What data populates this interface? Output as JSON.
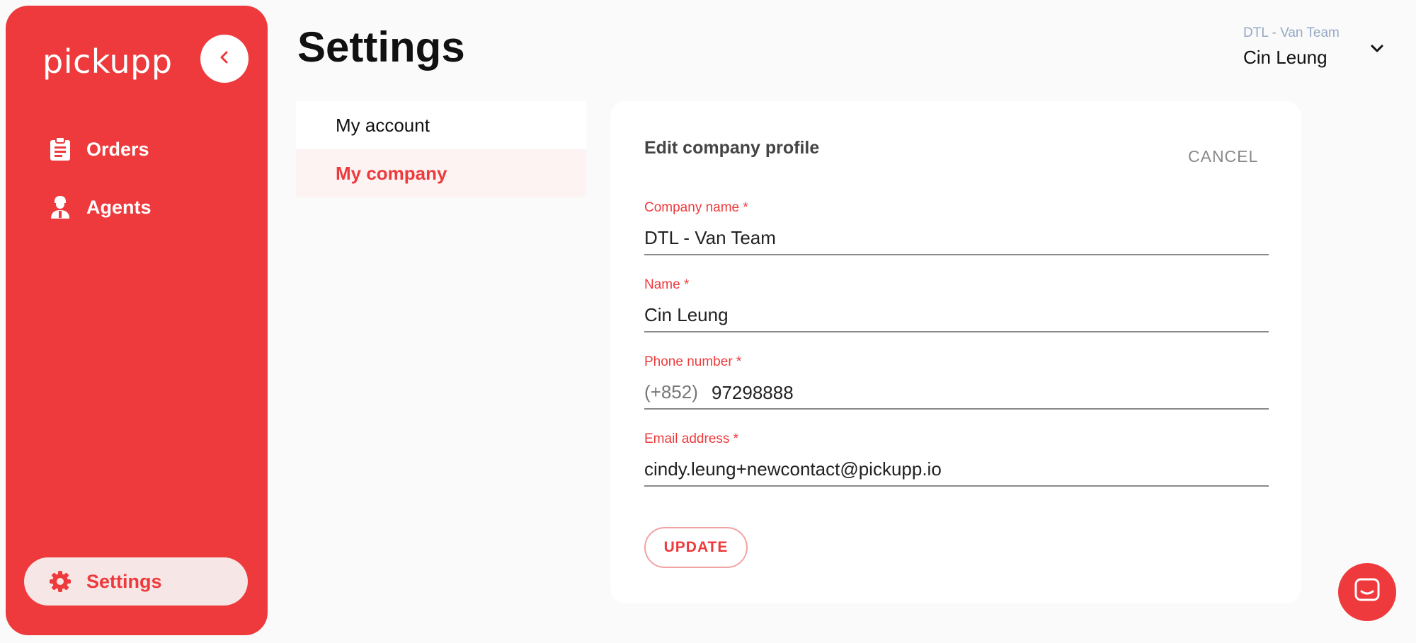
{
  "sidebar": {
    "logo_text": "pickupp",
    "collapse_icon": "chevron-left-icon",
    "items": [
      {
        "label": "Orders",
        "icon": "clipboard-icon"
      },
      {
        "label": "Agents",
        "icon": "agent-icon"
      },
      {
        "label": "Settings",
        "icon": "gear-icon",
        "active": true
      }
    ]
  },
  "header": {
    "title": "Settings",
    "account": {
      "company": "DTL - Van Team",
      "user": "Cin Leung",
      "icon": "chevron-down-icon"
    }
  },
  "settings_menu": {
    "items": [
      {
        "label": "My account",
        "active": false
      },
      {
        "label": "My company",
        "active": true
      }
    ]
  },
  "form": {
    "title": "Edit company profile",
    "cancel_label": "CANCEL",
    "fields": {
      "company_name": {
        "label": "Company name *",
        "value": "DTL - Van Team"
      },
      "name": {
        "label": "Name *",
        "value": "Cin Leung"
      },
      "phone": {
        "label": "Phone number *",
        "prefix": "(+852)",
        "value": "97298888"
      },
      "email": {
        "label": "Email address *",
        "value": "cindy.leung+newcontact@pickupp.io"
      }
    },
    "update_label": "UPDATE"
  },
  "chat": {
    "icon": "chat-icon"
  },
  "colors": {
    "brand": "#ee3a3c",
    "muted_blue": "#95a8c4",
    "background": "#fafafa"
  }
}
